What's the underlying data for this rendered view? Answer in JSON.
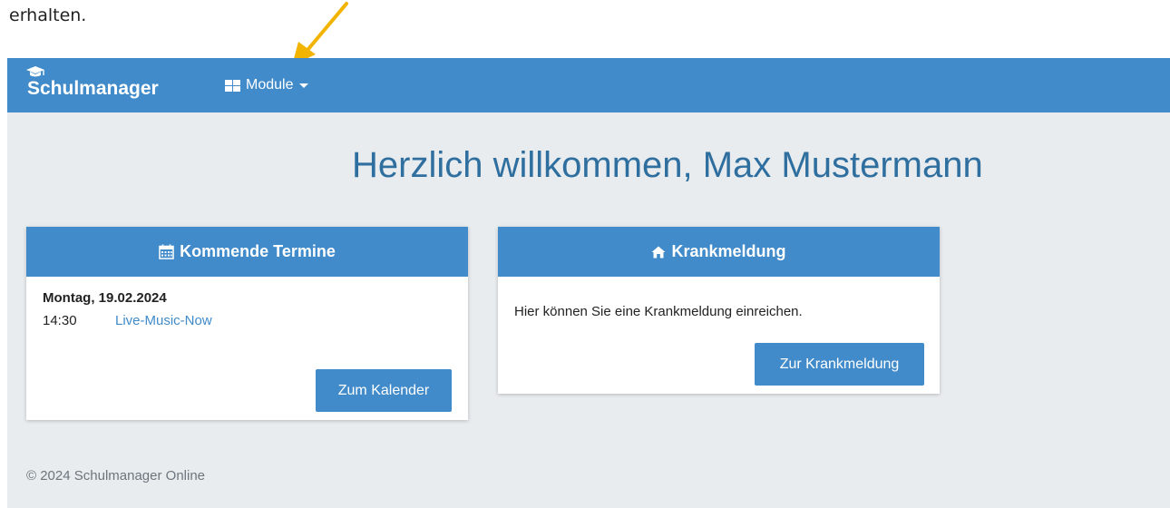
{
  "doc": {
    "top_text": "erhalten."
  },
  "annotation": {
    "arrow_color": "#f2b400",
    "arrow_icon": "arrow-down-left-icon"
  },
  "navbar": {
    "brand": "Schulmanager",
    "brand_icon": "graduation-cap-icon",
    "module_label": "Module",
    "module_icon": "grid-icon",
    "color": "#418bca"
  },
  "main": {
    "welcome": "Herzlich willkommen, Max Mustermann"
  },
  "termine_card": {
    "title": "Kommende Termine",
    "icon": "calendar-icon",
    "date": "Montag, 19.02.2024",
    "time": "14:30",
    "event": "Live-Music-Now",
    "button": "Zum Kalender"
  },
  "krank_card": {
    "title": "Krankmeldung",
    "icon": "home-icon",
    "text": "Hier können Sie eine Krankmeldung einreichen.",
    "button": "Zur Krankmeldung"
  },
  "footer": {
    "text": "© 2024 Schulmanager Online"
  }
}
